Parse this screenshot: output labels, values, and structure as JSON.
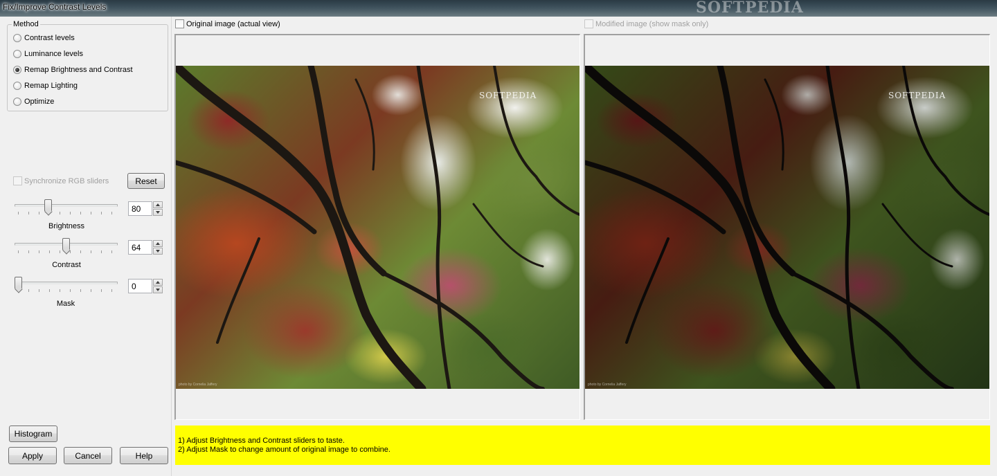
{
  "window": {
    "title": "Fix/Improve Contrast Levels",
    "watermark": "SOFTPEDIA"
  },
  "method": {
    "legend": "Method",
    "options": [
      {
        "label": "Contrast levels",
        "checked": false
      },
      {
        "label": "Luminance levels",
        "checked": false
      },
      {
        "label": "Remap Brightness and Contrast",
        "checked": true
      },
      {
        "label": "Remap Lighting",
        "checked": false
      },
      {
        "label": "Optimize",
        "checked": false
      }
    ]
  },
  "sync": {
    "label": "Synchronize RGB sliders",
    "checked": false,
    "enabled": false
  },
  "reset_label": "Reset",
  "sliders": [
    {
      "label": "Brightness",
      "value": "80",
      "min": 0,
      "max": 255,
      "level": 80
    },
    {
      "label": "Contrast",
      "value": "64",
      "min": 0,
      "max": 128,
      "level": 64
    },
    {
      "label": "Mask",
      "value": "0",
      "min": 0,
      "max": 100,
      "level": 0
    }
  ],
  "buttons": {
    "histogram": "Histogram",
    "apply": "Apply",
    "cancel": "Cancel",
    "help": "Help"
  },
  "previews": {
    "original_label": "Original image (actual view)",
    "modified_label": "Modified image (show mask only)",
    "image_watermark": "SOFTPEDIA",
    "image_credit": "photo by Cornelia Jaffery"
  },
  "hint": {
    "line1": "1) Adjust Brightness and Contrast sliders to taste.",
    "line2": "2) Adjust Mask to change amount of original image to combine."
  },
  "colors": {
    "hint_bg": "#ffff00",
    "dialog_bg": "#f0f0f0"
  }
}
